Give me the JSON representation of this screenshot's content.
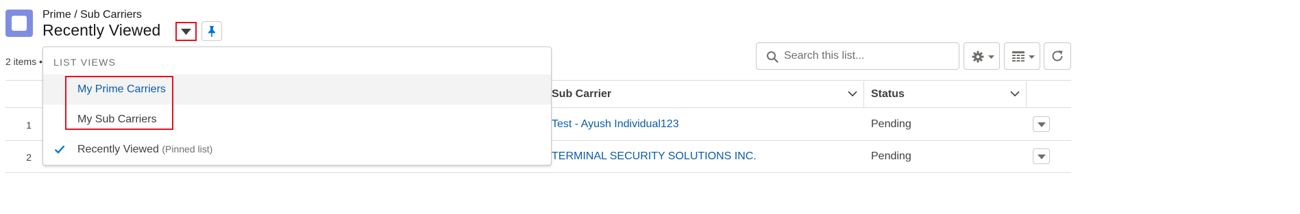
{
  "header": {
    "breadcrumb": "Prime / Sub Carriers",
    "title": "Recently Viewed",
    "object_icon": "list-object-icon",
    "caret_icon": "caret-down-icon",
    "pin_icon": "pin-icon"
  },
  "list_info": {
    "items_count": "2 items •"
  },
  "toolbar": {
    "search_placeholder": "Search this list...",
    "search_icon": "search-icon",
    "gear_icon": "gear-icon",
    "table_icon": "table-view-icon",
    "refresh_icon": "refresh-icon"
  },
  "table": {
    "columns": [
      {
        "label": "Sub Carrier"
      },
      {
        "label": "Status"
      }
    ],
    "rows": [
      {
        "num": "1",
        "sub_carrier": "Test - Ayush Individual123",
        "status": "Pending"
      },
      {
        "num": "2",
        "sub_carrier": "TERMINAL SECURITY SOLUTIONS INC.",
        "status": "Pending"
      }
    ]
  },
  "dropdown": {
    "header": "LIST VIEWS",
    "items": [
      {
        "label": "My Prime Carriers",
        "note": "",
        "selected": false,
        "hover": true
      },
      {
        "label": "My Sub Carriers",
        "note": "",
        "selected": false,
        "hover": false
      },
      {
        "label": "Recently Viewed",
        "note": "(Pinned list)",
        "selected": true,
        "hover": false
      }
    ]
  },
  "colors": {
    "link": "#0b5cab",
    "icon_bg": "#7f8de1",
    "highlight": "#e5101e",
    "check": "#0176d3"
  }
}
